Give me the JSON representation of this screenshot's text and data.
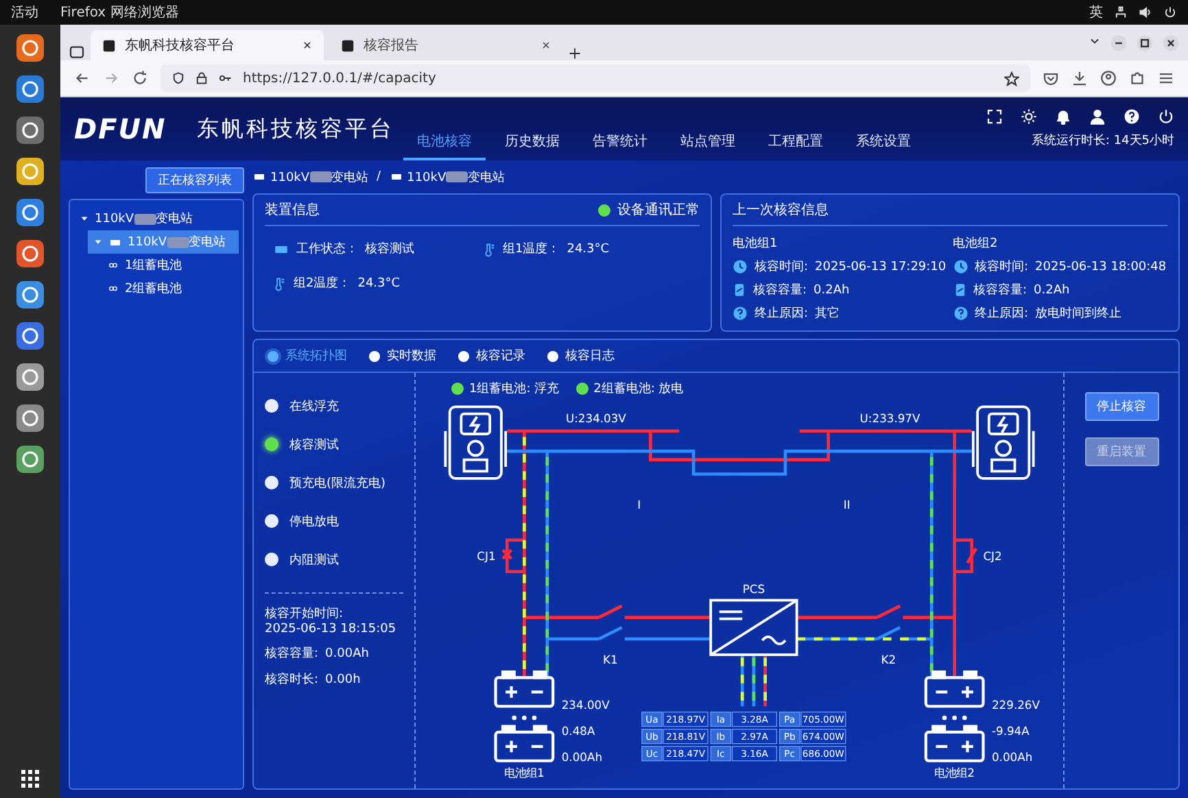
{
  "system_bar": {
    "activities": "活动",
    "app": "Firefox 网络浏览器",
    "input_method": "英"
  },
  "browser": {
    "tabs": [
      {
        "title": "东帆科技核容平台",
        "selected": true
      },
      {
        "title": "核容报告",
        "selected": false
      }
    ],
    "url": "https://127.0.0.1/#/capacity"
  },
  "header": {
    "logo": "DFUN",
    "title": "东帆科技核容平台",
    "runtime": "系统运行时长: 14天5小时",
    "nav": [
      {
        "label": "电池核容",
        "selected": true
      },
      {
        "label": "历史数据",
        "selected": false
      },
      {
        "label": "告警统计",
        "selected": false
      },
      {
        "label": "站点管理",
        "selected": false
      },
      {
        "label": "工程配置",
        "selected": false
      },
      {
        "label": "系统设置",
        "selected": false
      }
    ]
  },
  "sidebar": {
    "button": "正在核容列表",
    "tree": [
      {
        "parts": [
          "110kV",
          "变电站"
        ],
        "expanded": true,
        "selected": false,
        "children": [
          {
            "parts": [
              "110kV",
              "变电站"
            ],
            "expanded": true,
            "selected": true,
            "children": [
              {
                "parts": [
                  "1组蓄电池"
                ],
                "selected": false
              },
              {
                "parts": [
                  "2组蓄电池"
                ],
                "selected": false
              }
            ]
          }
        ]
      }
    ]
  },
  "breadcrumb": {
    "items": [
      {
        "parts": [
          "110kV",
          "变电站"
        ]
      },
      {
        "parts": [
          "110kV",
          "变电站"
        ]
      }
    ],
    "separator": "/"
  },
  "device_info": {
    "title": "装置信息",
    "comm_status": "设备通讯正常",
    "comm_ok": true,
    "fields": [
      {
        "kind": "status",
        "label": "工作状态：",
        "value": "核容测试"
      },
      {
        "kind": "temperature",
        "label": "组1温度：",
        "value": "24.3°C"
      },
      {
        "kind": "temperature",
        "label": "组2温度：",
        "value": "24.3°C"
      }
    ]
  },
  "last_test": {
    "title": "上一次核容信息",
    "groups": [
      {
        "name": "电池组1",
        "rows": [
          {
            "kind": "time",
            "label": "核容时间:",
            "value": "2025-06-13 17:29:10"
          },
          {
            "kind": "capacity",
            "label": "核容容量:",
            "value": "0.2Ah"
          },
          {
            "kind": "reason",
            "label": "终止原因:",
            "value": "其它"
          }
        ]
      },
      {
        "name": "电池组2",
        "rows": [
          {
            "kind": "time",
            "label": "核容时间:",
            "value": "2025-06-13 18:00:48"
          },
          {
            "kind": "capacity",
            "label": "核容容量:",
            "value": "0.2Ah"
          },
          {
            "kind": "reason",
            "label": "终止原因:",
            "value": "放电时间到终止"
          }
        ]
      }
    ]
  },
  "view_tabs": [
    {
      "label": "系统拓扑图",
      "selected": true
    },
    {
      "label": "实时数据",
      "selected": false
    },
    {
      "label": "核容记录",
      "selected": false
    },
    {
      "label": "核容日志",
      "selected": false
    }
  ],
  "modes": [
    {
      "label": "在线浮充",
      "active": false
    },
    {
      "label": "核容测试",
      "active": true
    },
    {
      "label": "预充电(限流充电)",
      "active": false
    },
    {
      "label": "停电放电",
      "active": false
    },
    {
      "label": "内阻测试",
      "active": false
    }
  ],
  "test_summary": [
    {
      "label": "核容开始时间:",
      "value": "2025-06-13 18:15:05",
      "kind": "stacked"
    },
    {
      "label": "核容容量:",
      "value": "0.00Ah",
      "kind": "inline"
    },
    {
      "label": "核容时长:",
      "value": "0.00h",
      "kind": "inline"
    }
  ],
  "topology": {
    "legend": [
      {
        "label": "1组蓄电池: 浮充",
        "active": true
      },
      {
        "label": "2组蓄电池: 放电",
        "active": true
      }
    ],
    "bus_voltages": [
      "U:234.03V",
      "U:233.97V"
    ],
    "bus_labels": [
      "I",
      "II"
    ],
    "contactors": [
      "CJ1",
      "CJ2"
    ],
    "switches": [
      "K1",
      "K2"
    ],
    "pcs": "PCS",
    "battery_groups": [
      {
        "name": "电池组1",
        "voltage": "234.00V",
        "current": "0.48A",
        "capacity": "0.00Ah"
      },
      {
        "name": "电池组2",
        "voltage": "229.26V",
        "current": "-9.94A",
        "capacity": "0.00Ah"
      }
    ],
    "pcs_table": [
      {
        "u_label": "Ua",
        "u": "218.97V",
        "i_label": "Ia",
        "i": "3.28A",
        "p_label": "Pa",
        "p": "705.00W"
      },
      {
        "u_label": "Ub",
        "u": "218.81V",
        "i_label": "Ib",
        "i": "2.97A",
        "p_label": "Pb",
        "p": "674.00W"
      },
      {
        "u_label": "Uc",
        "u": "218.47V",
        "i_label": "Ic",
        "i": "3.16A",
        "p_label": "Pc",
        "p": "686.00W"
      }
    ]
  },
  "actions": [
    {
      "label": "停止核容",
      "disabled": false
    },
    {
      "label": "重启装置",
      "disabled": true
    }
  ]
}
